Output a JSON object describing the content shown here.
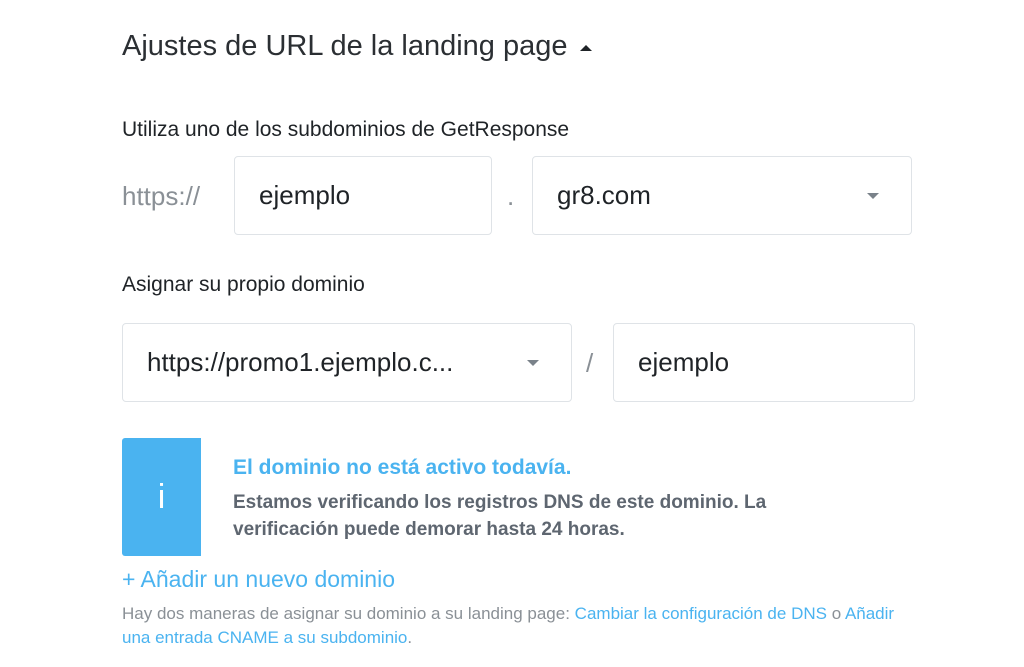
{
  "section": {
    "title": "Ajustes de URL de la landing page"
  },
  "subdomain": {
    "label": "Utiliza uno de los subdominios de GetResponse",
    "prefix": "https://",
    "name_value": "ejemplo",
    "separator": ".",
    "domain_value": "gr8.com"
  },
  "own_domain": {
    "label": "Asignar su propio dominio",
    "domain_value": "https://promo1.ejemplo.c...",
    "separator": "/",
    "path_value": "ejemplo"
  },
  "notice": {
    "icon": "i",
    "title": "El dominio no está activo todavía.",
    "body": "Estamos verificando los registros DNS de este dominio. La verificación puede demorar hasta 24 horas."
  },
  "add_domain": {
    "label": "+ Añadir un nuevo dominio"
  },
  "footnote": {
    "text_before": "Hay dos maneras de asignar su dominio a su landing page: ",
    "link1": "Cambiar la configuración de DNS",
    "text_middle": " o ",
    "link2": "Añadir una entrada CNAME a su subdominio",
    "text_after": "."
  },
  "colors": {
    "accent": "#4ab3f0",
    "muted": "#8a9096",
    "body_text": "#5e6670"
  }
}
